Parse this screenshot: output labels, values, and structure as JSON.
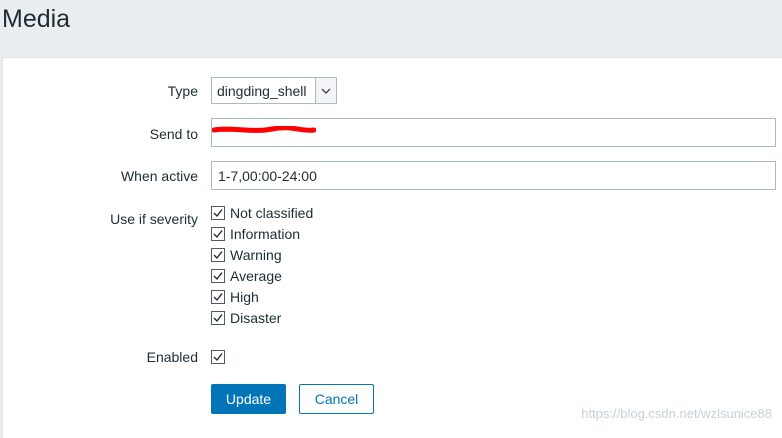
{
  "page": {
    "title": "Media"
  },
  "form": {
    "type": {
      "label": "Type",
      "value": "dingding_shell"
    },
    "send_to": {
      "label": "Send to",
      "value": ""
    },
    "when_active": {
      "label": "When active",
      "value": "1-7,00:00-24:00"
    },
    "severity": {
      "label": "Use if severity",
      "items": [
        {
          "label": "Not classified",
          "checked": true
        },
        {
          "label": "Information",
          "checked": true
        },
        {
          "label": "Warning",
          "checked": true
        },
        {
          "label": "Average",
          "checked": true
        },
        {
          "label": "High",
          "checked": true
        },
        {
          "label": "Disaster",
          "checked": true
        }
      ]
    },
    "enabled": {
      "label": "Enabled",
      "checked": true
    }
  },
  "buttons": {
    "update": "Update",
    "cancel": "Cancel"
  },
  "watermark": "https://blog.csdn.net/wzlsunice88",
  "colors": {
    "primary": "#0275b8",
    "redaction": "#ff0000"
  }
}
